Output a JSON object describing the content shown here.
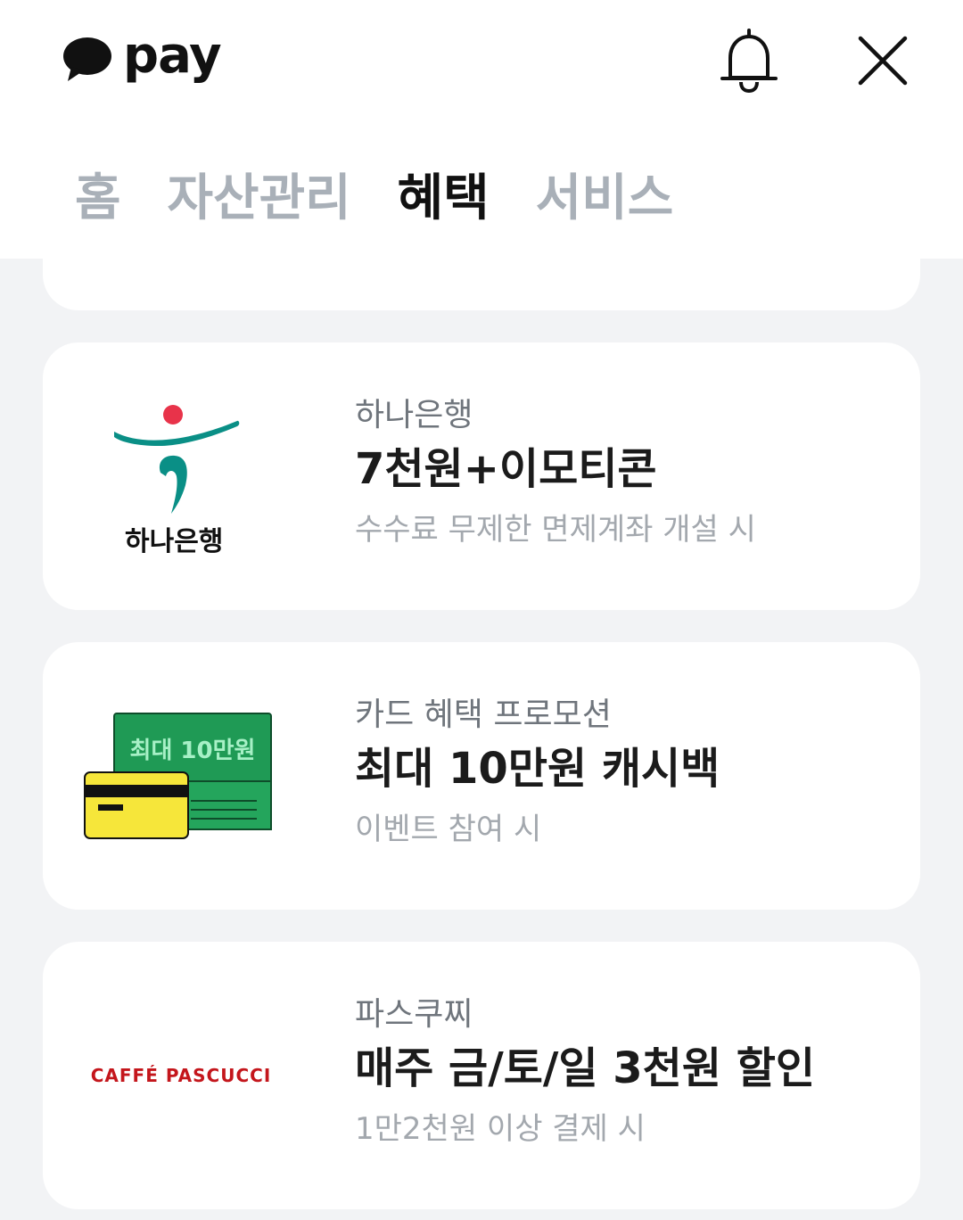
{
  "header": {
    "app_name": "pay",
    "tabs": [
      {
        "label": "홈",
        "active": false
      },
      {
        "label": "자산관리",
        "active": false
      },
      {
        "label": "혜택",
        "active": true
      },
      {
        "label": "서비스",
        "active": false
      }
    ]
  },
  "benefits": [
    {
      "brand_logo_text": "하나은행",
      "provider": "하나은행",
      "title": "7천원+이모티콘",
      "condition": "수수료 무제한 면제계좌 개설 시"
    },
    {
      "banner_text": "최대 10만원",
      "provider": "카드 혜택 프로모션",
      "title": "최대 10만원 캐시백",
      "condition": "이벤트 참여 시"
    },
    {
      "brand_logo_text": "CAFFÉ PASCUCCI",
      "provider": "파스쿠찌",
      "title": "매주 금/토/일 3천원 할인",
      "condition": "1만2천원 이상 결제 시"
    }
  ],
  "colors": {
    "background": "#f2f3f5",
    "card": "#ffffff",
    "hana_green": "#0a8f86",
    "hana_red": "#e8334a",
    "pascucci_red": "#c4161c",
    "money_green": "#1f9a55",
    "card_yellow": "#f6e63a"
  },
  "icons": {
    "logo": "kakao-speech-bubble-icon",
    "bell": "bell-icon",
    "close": "close-icon"
  }
}
